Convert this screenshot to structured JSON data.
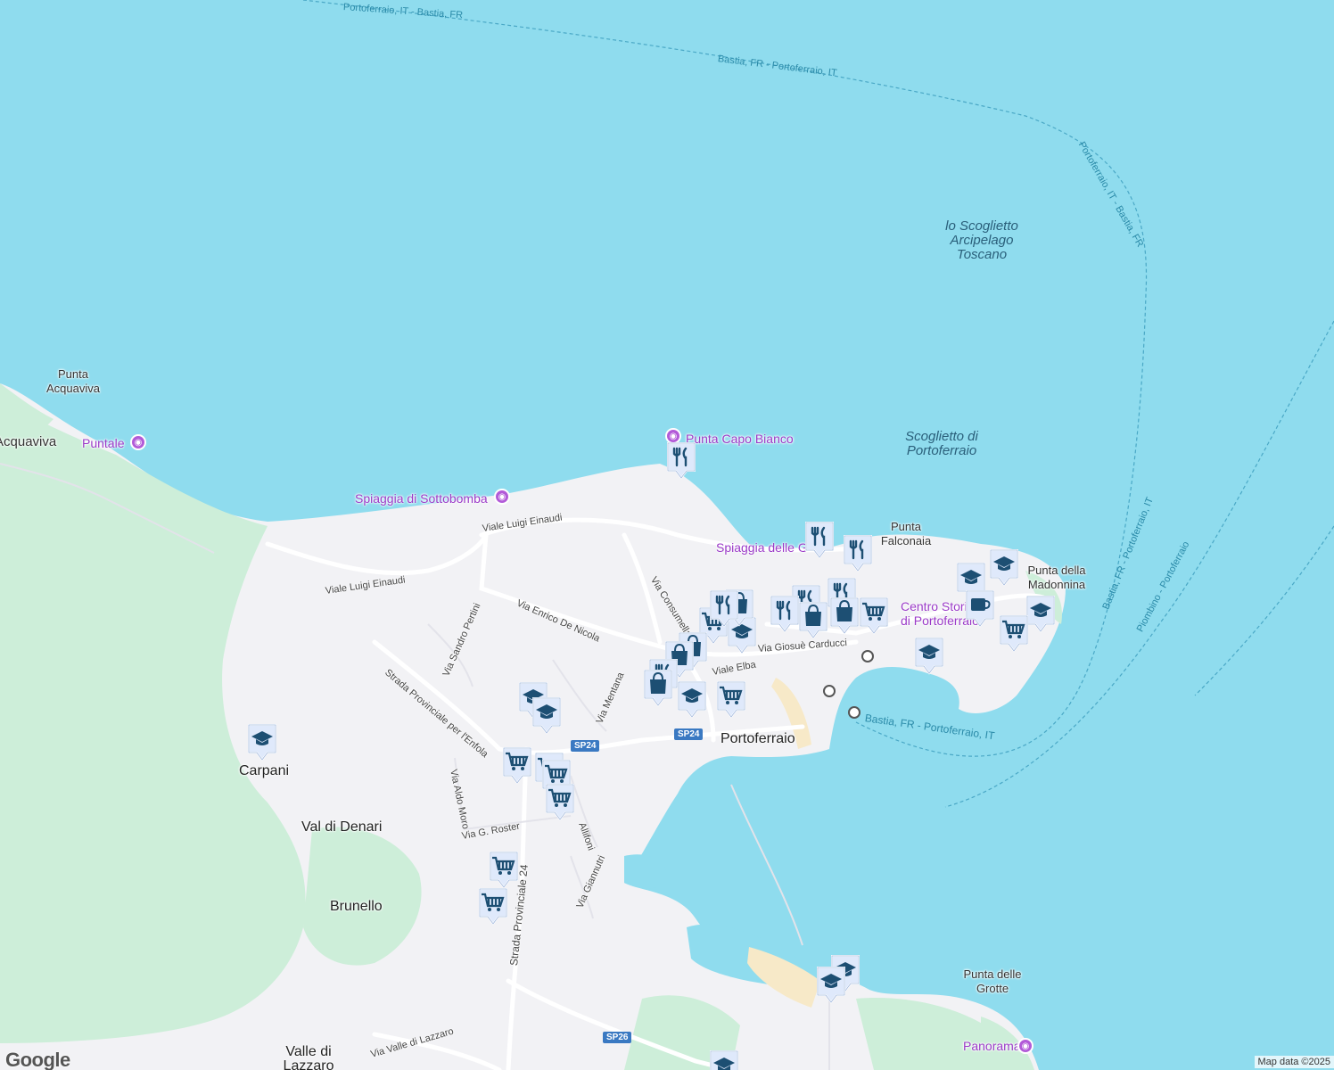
{
  "map": {
    "water_color": "#8fdcee",
    "land_color": "#f2f2f5",
    "park_color": "#cdeed9",
    "marker_color": "#1d4f73",
    "marker_bg": "#dfe9fb",
    "poi_color": "#b25ad8"
  },
  "place_labels": {
    "scoglietto": [
      "lo Scoglietto",
      "Arcipelago",
      "Toscano"
    ],
    "scoglietto_portoferraio": [
      "Scoglietto di",
      "Portoferraio"
    ],
    "punta_acquaviva": [
      "Punta",
      "Acquaviva"
    ],
    "acquaviva": "Acquaviva",
    "punta_falconaia": [
      "Punta",
      "Falconaia"
    ],
    "punta_madonnina": [
      "Punta della",
      "Madonnina"
    ],
    "centro_storico": [
      "Centro Storico",
      "di Portoferraio"
    ],
    "portoferraio": "Portoferraio",
    "carpani": "Carpani",
    "val_di_denari": "Val di Denari",
    "brunello": "Brunello",
    "valle_di_lazzaro": [
      "Valle di",
      "Lazzaro"
    ],
    "punta_grotte": [
      "Punta delle",
      "Grotte"
    ]
  },
  "poi_labels": {
    "puntale": "Puntale",
    "punta_capo_bianco": "Punta Capo Bianco",
    "spiaggia_sottobomba": "Spiaggia di Sottobomba",
    "spiaggia_delle_g": "Spiaggia delle G",
    "panorama": "Panorama"
  },
  "ferry_labels": {
    "top": "Portoferraio, IT - Bastia, FR",
    "arc1": "Bastia, FR - Portoferraio, IT",
    "arc2": "Portoferraio, IT - Bastia, FR",
    "harbor": "Bastia, FR - Portoferraio, IT",
    "right1": "Bastia, FR - Portoferraio, IT",
    "right2": "Piombino - Portoferraio"
  },
  "street_labels": {
    "einaudi1": "Viale Luigi Einaudi",
    "einaudi2": "Viale Luigi Einaudi",
    "de_nicola": "Via Enrico De Nicola",
    "consumella": "Via Consumella",
    "pertini": "Via Sandro Pertini",
    "enfola": "Strada Provinciale per l'Enfola",
    "mentana": "Via Mentana",
    "elba": "Viale Elba",
    "carducci": "Via Giosuè Carducci",
    "aldo_moro": "Via Aldo Moro",
    "roster": "Via G. Roster",
    "allifoni": "Allifoni",
    "giannutri": "Via Giannutri",
    "sp24_road": "Strada Provinciale 24",
    "valle_lazzaro": "Via Valle di Lazzaro"
  },
  "road_shields": {
    "sp24_a": "SP24",
    "sp24_b": "SP24",
    "sp26": "SP26"
  },
  "branding": {
    "logo": "Google",
    "attribution": "Map data ©2025"
  }
}
